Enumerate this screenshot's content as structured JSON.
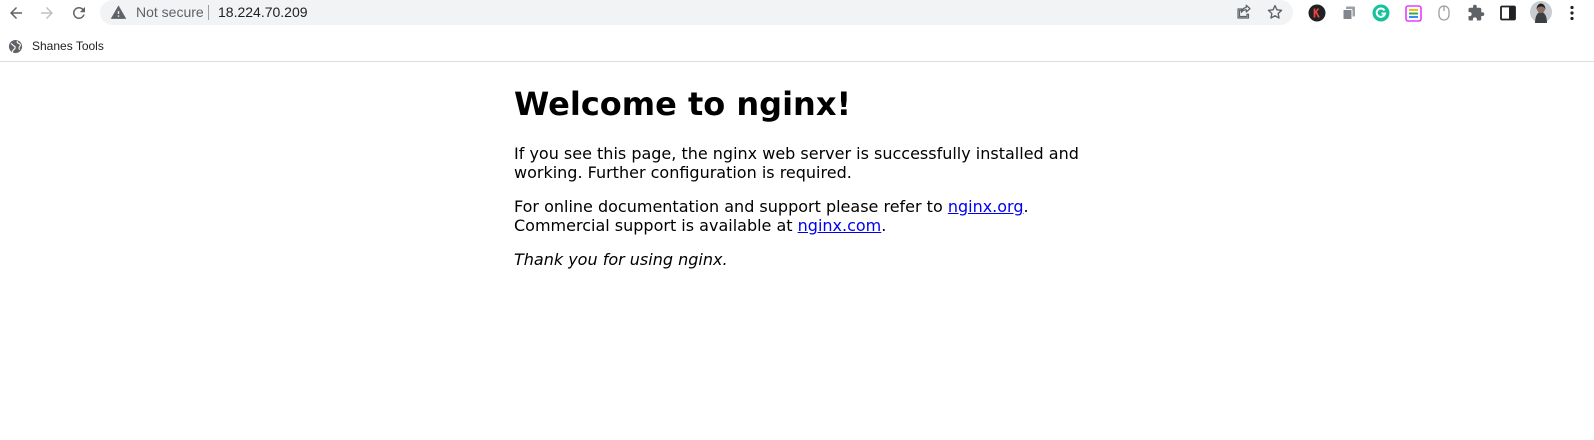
{
  "browser": {
    "security_label": "Not secure",
    "url": "18.224.70.209",
    "nav_icons": [
      "back-icon",
      "forward-icon",
      "reload-icon"
    ],
    "omnibox_icons": [
      "warning-icon",
      "share-icon",
      "star-icon"
    ],
    "extensions": [
      "k-extension-icon",
      "copy-extension-icon",
      "grammarly-icon",
      "grid-extension-icon",
      "mouse-extension-icon",
      "puzzle-icon",
      "side-panel-icon",
      "profile-avatar",
      "kebab-menu-icon"
    ],
    "colors": {
      "omnibox_bg": "#f1f3f4",
      "grammarly": "#15c39a",
      "link": "#0000ee"
    }
  },
  "bookmarks": [
    {
      "label": "Shanes Tools",
      "icon": "globe-icon"
    }
  ],
  "content": {
    "title": "Welcome to nginx!",
    "para1_line1": "If you see this page, the nginx web server is successfully installed and",
    "para1_line2": "working. Further configuration is required.",
    "para2_line1_prefix": "For online documentation and support please refer to ",
    "link_org": "nginx.org",
    "para2_line1_suffix": ".",
    "para2_line2_prefix": "Commercial support is available at ",
    "link_com": "nginx.com",
    "para2_line2_suffix": ".",
    "para3": "Thank you for using nginx."
  }
}
